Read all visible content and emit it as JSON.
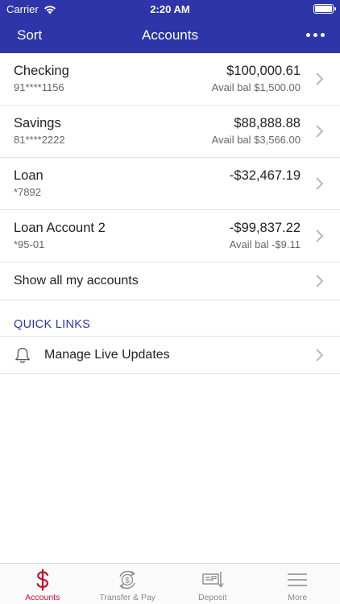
{
  "status_bar": {
    "carrier": "Carrier",
    "time": "2:20 AM"
  },
  "nav": {
    "left_label": "Sort",
    "title": "Accounts",
    "menu_icon": "ellipsis-icon"
  },
  "accounts": [
    {
      "name": "Checking",
      "number": "91****1156",
      "balance": "$100,000.61",
      "available": "Avail bal $1,500.00"
    },
    {
      "name": "Savings",
      "number": "81****2222",
      "balance": "$88,888.88",
      "available": "Avail bal $3,566.00"
    },
    {
      "name": "Loan",
      "number": "*7892",
      "balance": "-$32,467.19",
      "available": ""
    },
    {
      "name": "Loan Account 2",
      "number": "*95-01",
      "balance": "-$99,837.22",
      "available": "Avail bal -$9.11"
    }
  ],
  "show_all_label": "Show all my accounts",
  "quick_links": {
    "heading": "QUICK LINKS",
    "items": [
      {
        "label": "Manage Live Updates",
        "icon": "bell-icon"
      }
    ]
  },
  "tabbar": {
    "items": [
      {
        "label": "Accounts",
        "icon": "dollar-icon",
        "active": true
      },
      {
        "label": "Transfer & Pay",
        "icon": "transfer-pay-icon",
        "active": false
      },
      {
        "label": "Deposit",
        "icon": "check-deposit-icon",
        "active": false
      },
      {
        "label": "More",
        "icon": "hamburger-menu-icon",
        "active": false
      }
    ]
  },
  "colors": {
    "brand_blue": "#2d35a8",
    "active_tab_red": "#c8102e",
    "inactive_gray": "#8a8a8e"
  }
}
